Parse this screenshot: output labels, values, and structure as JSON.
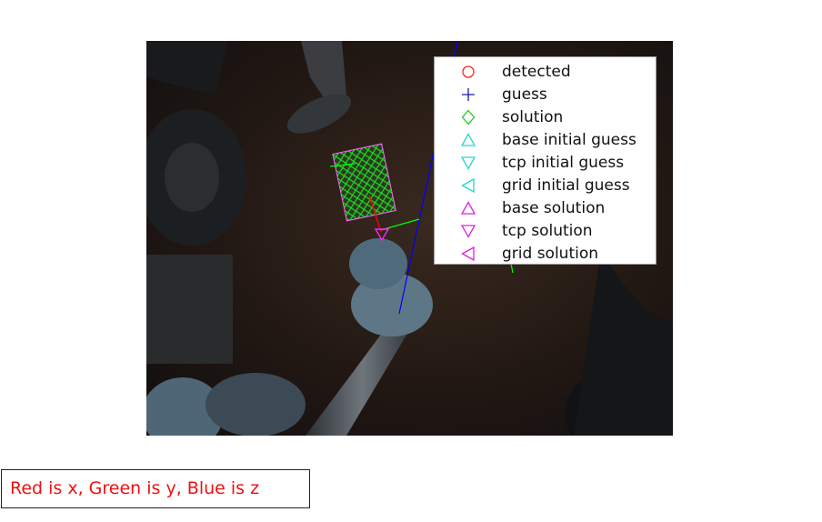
{
  "legend": {
    "items": [
      {
        "label": "detected",
        "marker": "circle-icon",
        "color": "#ff2020"
      },
      {
        "label": "guess",
        "marker": "plus-icon",
        "color": "#1a1aa8"
      },
      {
        "label": "solution",
        "marker": "diamond-icon",
        "color": "#22cc22"
      },
      {
        "label": "base initial guess",
        "marker": "triangle-up-icon",
        "color": "#22d6d6"
      },
      {
        "label": "tcp initial guess",
        "marker": "triangle-down-icon",
        "color": "#22d6d6"
      },
      {
        "label": "grid initial guess",
        "marker": "triangle-left-icon",
        "color": "#22d6d6"
      },
      {
        "label": "base solution",
        "marker": "triangle-up-icon",
        "color": "#dd22dd"
      },
      {
        "label": "tcp solution",
        "marker": "triangle-down-icon",
        "color": "#dd22dd"
      },
      {
        "label": "grid solution",
        "marker": "triangle-left-icon",
        "color": "#dd22dd"
      }
    ]
  },
  "caption": {
    "text": "Red is x, Green is y, Blue is z"
  },
  "colors": {
    "x_axis": "#ff0000",
    "y_axis": "#00ff00",
    "z_axis": "#0000ff"
  }
}
